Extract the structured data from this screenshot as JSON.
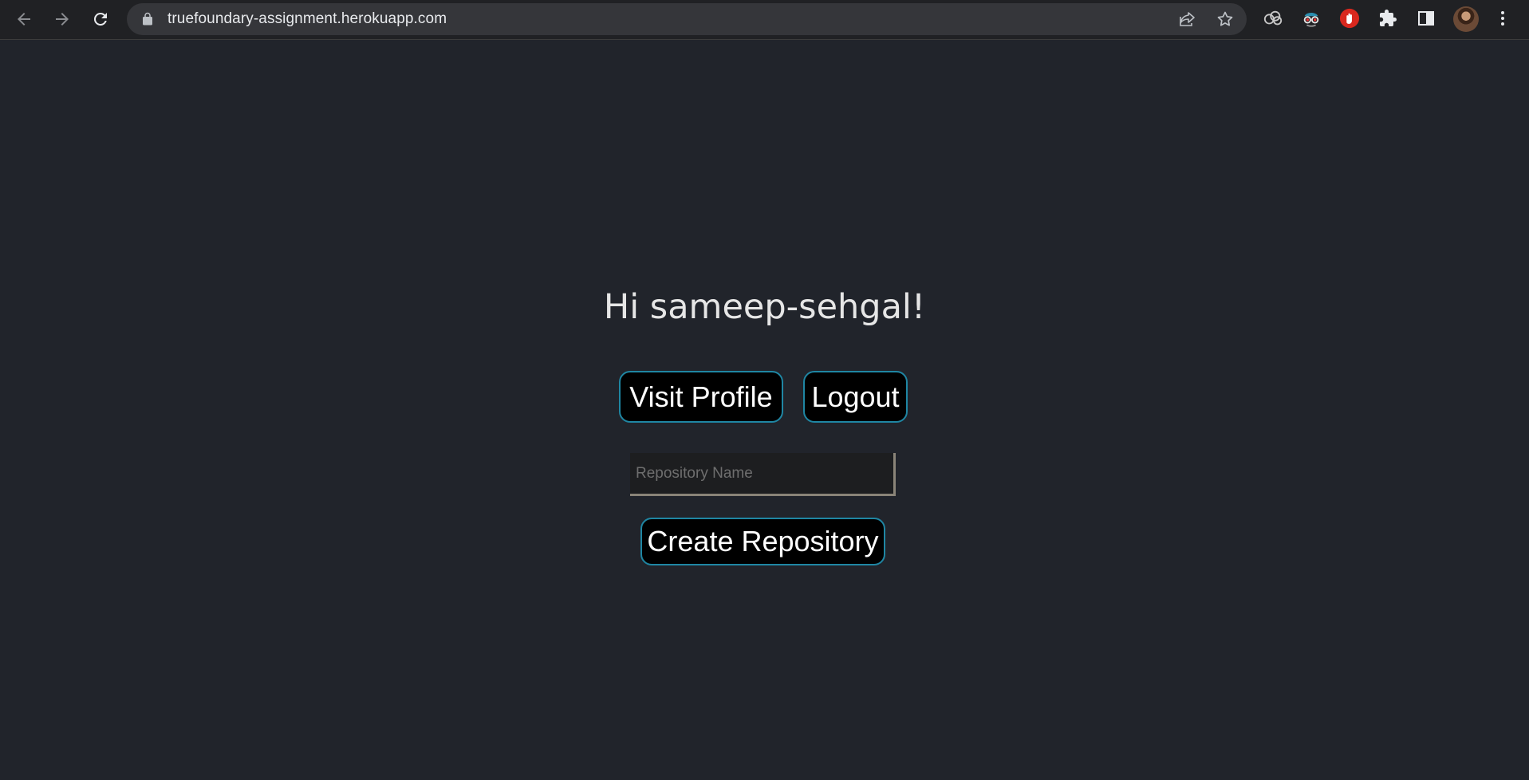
{
  "browser": {
    "url": "truefoundary-assignment.herokuapp.com"
  },
  "page": {
    "greeting": "Hi sameep-sehgal!",
    "visit_profile_label": "Visit Profile",
    "logout_label": "Logout",
    "repo_placeholder": "Repository Name",
    "repo_value": "",
    "create_label": "Create Repository"
  },
  "colors": {
    "page_background": "#21242b",
    "button_border": "#1f86a3",
    "button_background": "#000000"
  }
}
